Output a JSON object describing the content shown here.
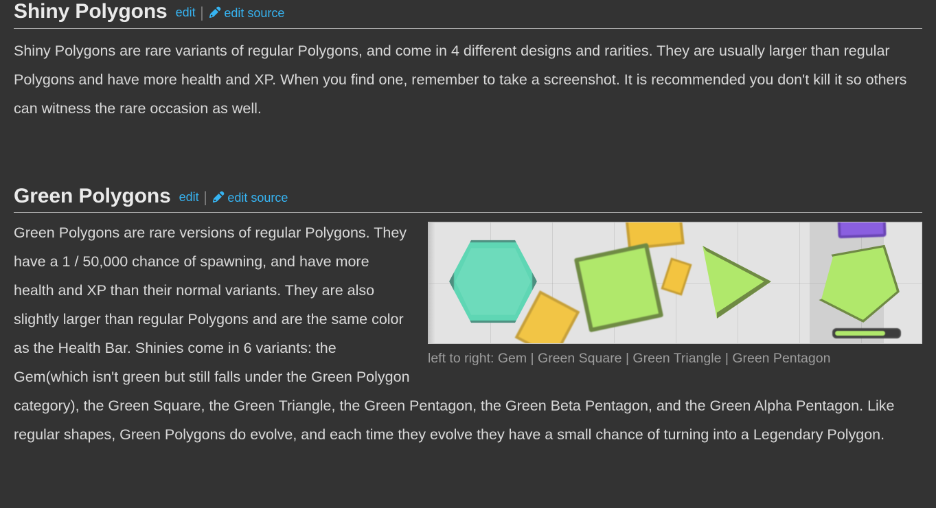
{
  "theme": {
    "background": "#333333",
    "text_color": "#d9d9d9",
    "heading_color": "#eaeaea",
    "link_color": "#36b4f2",
    "rule_color": "#a7a7a7",
    "caption_color": "#9d9d9d"
  },
  "sections": [
    {
      "title": "Shiny Polygons",
      "edit_label": "edit",
      "separator": "|",
      "edit_source_label": "edit source",
      "pencil_icon": "pencil-icon",
      "paragraph": "Shiny Polygons are rare variants of regular Polygons, and come in 4 different designs and rarities. They are usually larger than regular Polygons and have more health and XP. When you find one, remember to take a screenshot. It is recommended you don't kill it so others can witness the rare occasion as well."
    },
    {
      "title": "Green Polygons",
      "edit_label": "edit",
      "separator": "|",
      "edit_source_label": "edit source",
      "pencil_icon": "pencil-icon",
      "paragraph": "Green Polygons are rare versions of regular Polygons. They have a 1 / 50,000 chance of spawning, and have more health and XP than their normal variants. They are also slightly larger than regular Polygons and are the same color as the Health Bar. Shinies come in 6 variants: the Gem(which isn't green but still falls under the Green Polygon category), the Green Square, the Green Triangle, the Green Pentagon, the Green Beta Pentagon, and the Green Alpha Pentagon. Like regular shapes, Green Polygons do evolve, and each time they evolve they have a small chance of turning into a Legendary Polygon.",
      "figure": {
        "caption_prefix": "left to right:",
        "caption_items": [
          "Gem",
          "Green Square",
          "Green Triangle",
          "Green Pentagon"
        ],
        "caption_separator": "|",
        "caption_full": "left to right: Gem | Green Square | Green Triangle | Green Pentagon",
        "alt": "Screenshot showing a teal Gem hexagon, a green square, a green triangle and a green pentagon on a light game grid",
        "shapes": [
          {
            "name": "gem-hexagon",
            "fill": "#6ddbbb",
            "stroke": "#4d8f80"
          },
          {
            "name": "gold-triangle",
            "fill": "#f2c545",
            "stroke": "#c6a03a"
          },
          {
            "name": "gold-square",
            "fill": "#f2c33f",
            "stroke": "#c79f34"
          },
          {
            "name": "green-square",
            "fill": "#b0e86b",
            "stroke": "#6f8a44"
          },
          {
            "name": "green-triangle",
            "fill": "#b0e86b",
            "stroke": "#6f8a44"
          },
          {
            "name": "green-pentagon",
            "fill": "#b0e86b",
            "stroke": "#6f8a44"
          },
          {
            "name": "purple-shape",
            "fill": "#8a5fe0",
            "stroke": "#6a45b5"
          },
          {
            "name": "health-bar",
            "fill": "#b0e86b",
            "stroke": "#3d3d3d"
          }
        ]
      }
    }
  ]
}
